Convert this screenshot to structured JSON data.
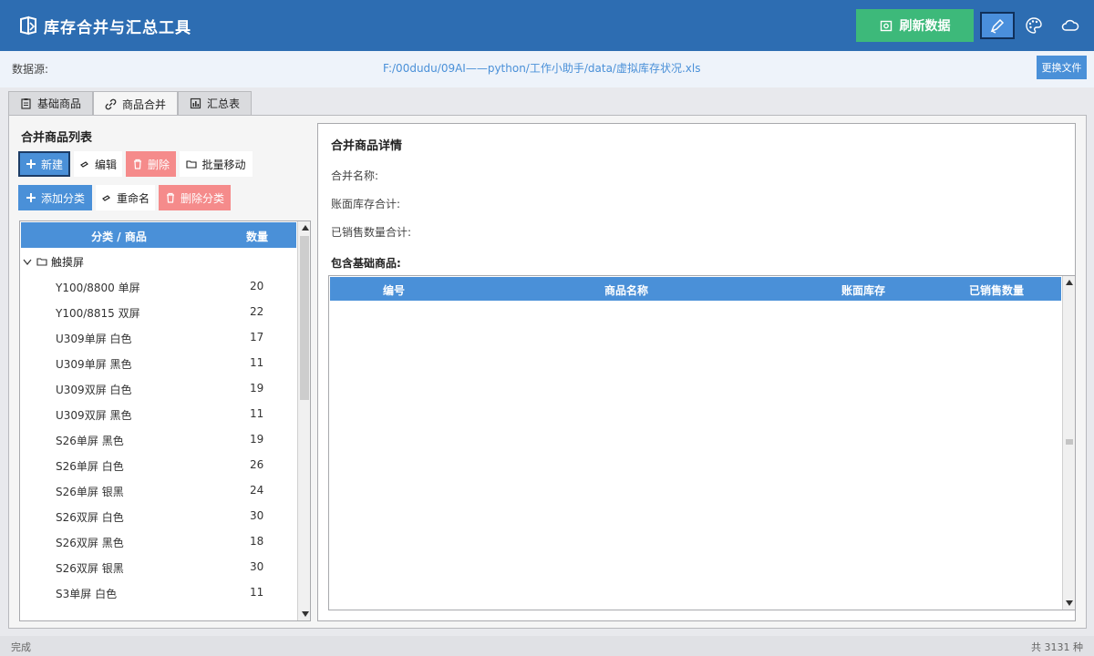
{
  "app": {
    "title": "库存合并与汇总工具"
  },
  "toolbar": {
    "refresh_label": "刷新数据"
  },
  "source": {
    "label": "数据源:",
    "path": "F:/00dudu/09AI——python/工作小助手/data/虚拟库存状况.xls",
    "change_label": "更换文件"
  },
  "tabs": [
    {
      "label": "基础商品",
      "icon": "clipboard-icon"
    },
    {
      "label": "商品合并",
      "icon": "link-icon"
    },
    {
      "label": "汇总表",
      "icon": "chart-icon"
    }
  ],
  "left": {
    "title": "合并商品列表",
    "buttons": {
      "new": "新建",
      "edit": "编辑",
      "delete": "删除",
      "batch_move": "批量移动",
      "add_category": "添加分类",
      "rename": "重命名",
      "delete_category": "删除分类"
    },
    "columns": {
      "name": "分类 / 商品",
      "qty": "数量"
    },
    "group": "触摸屏",
    "rows": [
      {
        "name": "Y100/8800 单屏",
        "qty": "20"
      },
      {
        "name": "Y100/8815 双屏",
        "qty": "22"
      },
      {
        "name": "U309单屏 白色",
        "qty": "17"
      },
      {
        "name": "U309单屏 黑色",
        "qty": "11"
      },
      {
        "name": "U309双屏 白色",
        "qty": "19"
      },
      {
        "name": "U309双屏 黑色",
        "qty": "11"
      },
      {
        "name": "S26单屏 黑色",
        "qty": "19"
      },
      {
        "name": "S26单屏 白色",
        "qty": "26"
      },
      {
        "name": "S26单屏 银黑",
        "qty": "24"
      },
      {
        "name": "S26双屏 白色",
        "qty": "30"
      },
      {
        "name": "S26双屏 黑色",
        "qty": "18"
      },
      {
        "name": "S26双屏 银黑",
        "qty": "30"
      },
      {
        "name": "S3单屏 白色",
        "qty": "11"
      }
    ]
  },
  "detail": {
    "title": "合并商品详情",
    "merge_name_label": "合并名称:",
    "stock_total_label": "账面库存合计:",
    "sold_total_label": "已销售数量合计:",
    "contains_label": "包含基础商品:",
    "columns": {
      "id": "编号",
      "name": "商品名称",
      "stock": "账面库存",
      "sold": "已销售数量"
    }
  },
  "status": {
    "left": "完成",
    "right": "共 3131 种"
  },
  "colors": {
    "titlebar": "#2d6db2",
    "accent": "#4a90d8",
    "success": "#3db97a",
    "danger": "#f58b8b"
  }
}
